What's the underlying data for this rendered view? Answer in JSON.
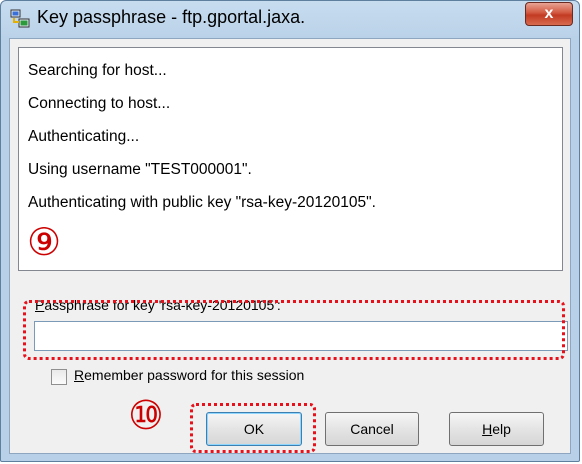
{
  "window": {
    "title": "Key passphrase - ftp.gportal.jaxa.",
    "close_symbol": "x"
  },
  "log": {
    "lines": [
      "Searching for host...",
      "Connecting to host...",
      "Authenticating...",
      "Using username \"TEST000001\".",
      "Authenticating with public key \"rsa-key-20120105\"."
    ]
  },
  "annotations": {
    "marker_9": "⑨",
    "marker_10": "⑩",
    "highlight_color": "#e8101a"
  },
  "passphrase": {
    "label_mnemonic": "P",
    "label_rest": "assphrase for key 'rsa-key-20120105':",
    "value": ""
  },
  "remember": {
    "mnemonic": "R",
    "label_rest": "emember password for this session",
    "checked": false
  },
  "buttons": {
    "ok": "OK",
    "cancel": "Cancel",
    "help_mnemonic": "H",
    "help_rest": "elp"
  },
  "icons": {
    "app": "putty-computers-icon",
    "close": "close-icon",
    "checkbox": "checkbox-icon"
  }
}
